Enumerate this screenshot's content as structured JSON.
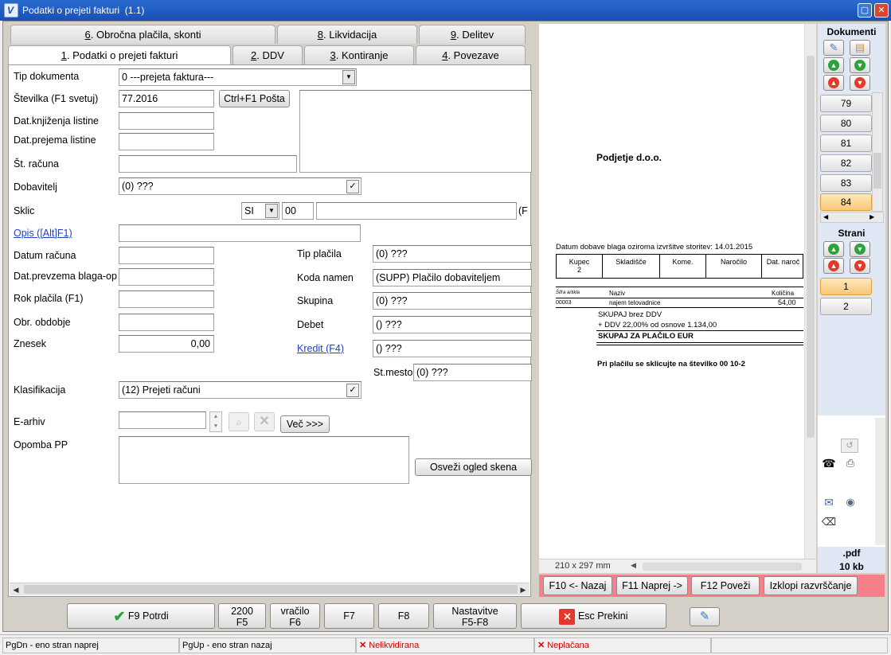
{
  "window": {
    "title": "Podatki o prejeti fakturi  (1.1)",
    "minimize": "▢",
    "close": "✕"
  },
  "tabs_row1": [
    {
      "prefix": "6",
      "label": ". Obročna plačila, skonti"
    },
    {
      "prefix": "8",
      "label": ". Likvidacija"
    },
    {
      "prefix": "9",
      "label": ". Delitev"
    }
  ],
  "tabs_row2": [
    {
      "prefix": "1",
      "label": ". Podatki o prejeti fakturi"
    },
    {
      "prefix": "2",
      "label": ". DDV"
    },
    {
      "prefix": "3",
      "label": ". Kontiranje"
    },
    {
      "prefix": "4",
      "label": ". Povezave"
    }
  ],
  "form": {
    "tip_dokumenta": {
      "label": "Tip dokumenta",
      "value": "0 ---prejeta faktura---"
    },
    "stevilka": {
      "label": "Številka (F1 svetuj)",
      "value": "77.2016",
      "button": "Ctrl+F1 Pošta"
    },
    "dat_knjizenja": {
      "label": "Dat.knjiženja listine",
      "value": ""
    },
    "dat_prejema": {
      "label": "Dat.prejema listine",
      "value": ""
    },
    "st_racuna": {
      "label": "Št. računa",
      "value": ""
    },
    "dobavitelj": {
      "label": "Dobavitelj",
      "value": "(0) ???"
    },
    "sklic": {
      "label": "Sklic",
      "country": "SI",
      "model": "00",
      "value": "",
      "suffix": "(F"
    },
    "opis": {
      "label": "Opis ([Alt]F1)",
      "value": ""
    },
    "datum_racuna": {
      "label": "Datum računa",
      "value": ""
    },
    "dat_prevzema": {
      "label": "Dat.prevzema blaga-op",
      "value": ""
    },
    "rok_placila": {
      "label": "Rok plačila (F1)",
      "value": ""
    },
    "obr_obdobje": {
      "label": "Obr. obdobje",
      "value": ""
    },
    "znesek": {
      "label": "Znesek",
      "value": "0,00"
    },
    "tip_placila": {
      "label": "Tip plačila",
      "value": "(0) ???"
    },
    "koda_namen": {
      "label": "Koda namen",
      "value": "(SUPP) Plačilo dobaviteljem"
    },
    "skupina": {
      "label": "Skupina",
      "value": "(0) ???"
    },
    "debet": {
      "label": "Debet",
      "value": "() ???"
    },
    "kredit": {
      "label": "Kredit (F4)",
      "value": "() ???"
    },
    "st_mesto": {
      "label": "St.mesto",
      "value": "(0) ???"
    },
    "klasifikacija": {
      "label": "Klasifikacija",
      "value": "(12) Prejeti računi"
    },
    "earhiv": {
      "label": "E-arhiv",
      "value": "",
      "more_button": "Več >>>"
    },
    "opomba": {
      "label": "Opomba PP",
      "value": ""
    },
    "osvezi_button": "Osveži ogled skena"
  },
  "preview": {
    "company": "Podjetje d.o.o.",
    "delivery_line": "Datum dobave blaga oziroma izvršitve storitev: 14.01.2015",
    "table_headers": [
      "Kupec",
      "Skladišče",
      "Kome.",
      "Naročilo",
      "Dat. naroč"
    ],
    "kupec_value": "2",
    "item_headers": [
      "Šifra artikla",
      "Naziv",
      "Količina"
    ],
    "item": {
      "code": "00003",
      "name": "najem telovadnice",
      "qty": "54,00"
    },
    "skupaj_brez": "SKUPAJ brez DDV",
    "ddv_line": "+ DDV 22,00% od osnove 1.134,00",
    "skupaj_placilo": "SKUPAJ ZA PLAČILO EUR",
    "sklic_note": "Pri plačilu se sklicujte na številko 00 10-2",
    "page_size": "210 x 297 mm"
  },
  "sidebar": {
    "dokumenti_title": "Dokumenti",
    "doc_numbers": [
      "79",
      "80",
      "81",
      "82",
      "83",
      "84"
    ],
    "selected_doc": "84",
    "strani_title": "Strani",
    "pages": [
      "1",
      "2"
    ],
    "selected_page": "1",
    "file_ext": ".pdf",
    "file_size": "10 kb"
  },
  "preview_buttons": [
    "F10 <- Nazaj",
    "F11 Naprej ->",
    "F12 Poveži",
    "Izklopi razvrščanje"
  ],
  "toolbar": {
    "potrdi": "F9 Potrdi",
    "f5_top": "2200",
    "f5_bottom": "F5",
    "f6_top": "vračilo",
    "f6_bottom": "F6",
    "f7": "F7",
    "f8": "F8",
    "nast_top": "Nastavitve",
    "nast_bottom": "F5-F8",
    "prekini": "Esc Prekini"
  },
  "status": {
    "pgdn": "PgDn - eno stran naprej",
    "pgup": "PgUp - eno stran nazaj",
    "nelikvidirana": "Nelikvidirana",
    "neplacana": "Neplačana"
  }
}
